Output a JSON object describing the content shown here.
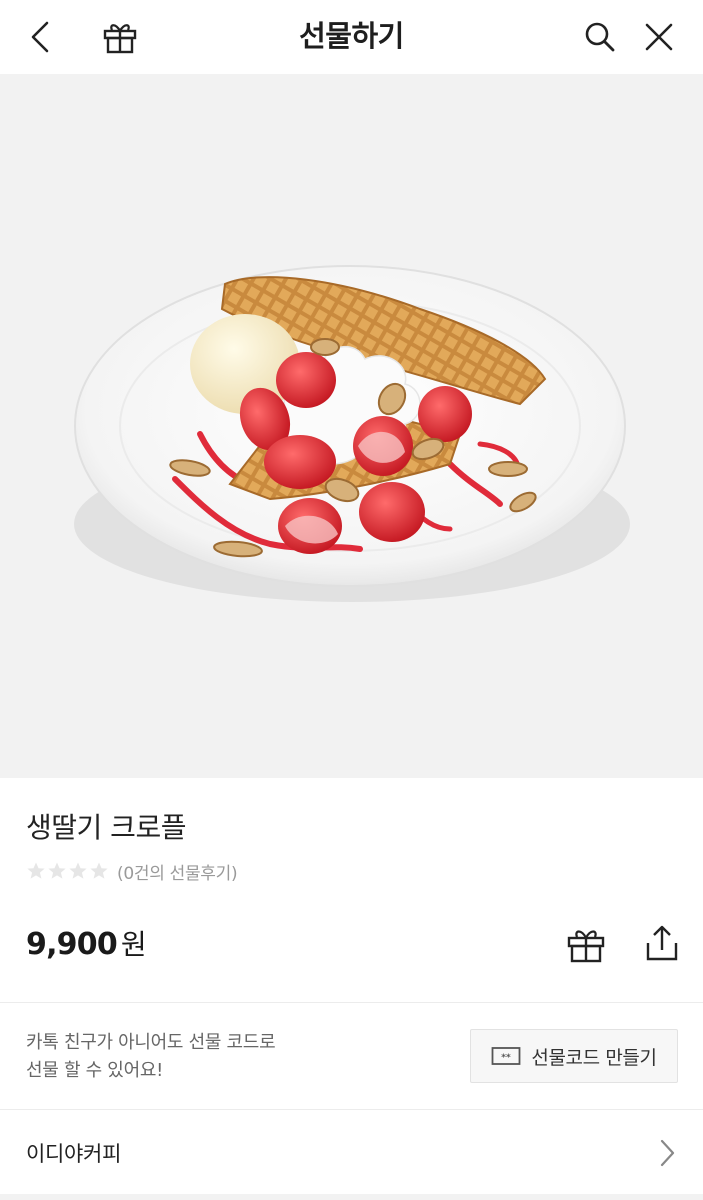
{
  "header": {
    "title": "선물하기",
    "icons": [
      "chevron-left-icon",
      "gift-icon",
      "search-icon",
      "close-icon"
    ]
  },
  "hero_image": {
    "alt": "생딸기 크로플"
  },
  "product": {
    "name": "생딸기 크로플",
    "rating_stars": 0,
    "review_count_text": "(0건의 선물후기)",
    "price": "9,900",
    "price_unit": "원"
  },
  "gift_code": {
    "line1": "카톡 친구가 아니어도 선물 코드로",
    "line2": "선물 할 수 있어요!",
    "button_label": "선물코드 만들기"
  },
  "brand": {
    "name": "이디야커피"
  },
  "colors": {
    "hero_bg": "#f2f2f2",
    "text_primary": "#1e1e1e",
    "text_secondary": "#9a9a9a",
    "divider": "#ececec"
  }
}
